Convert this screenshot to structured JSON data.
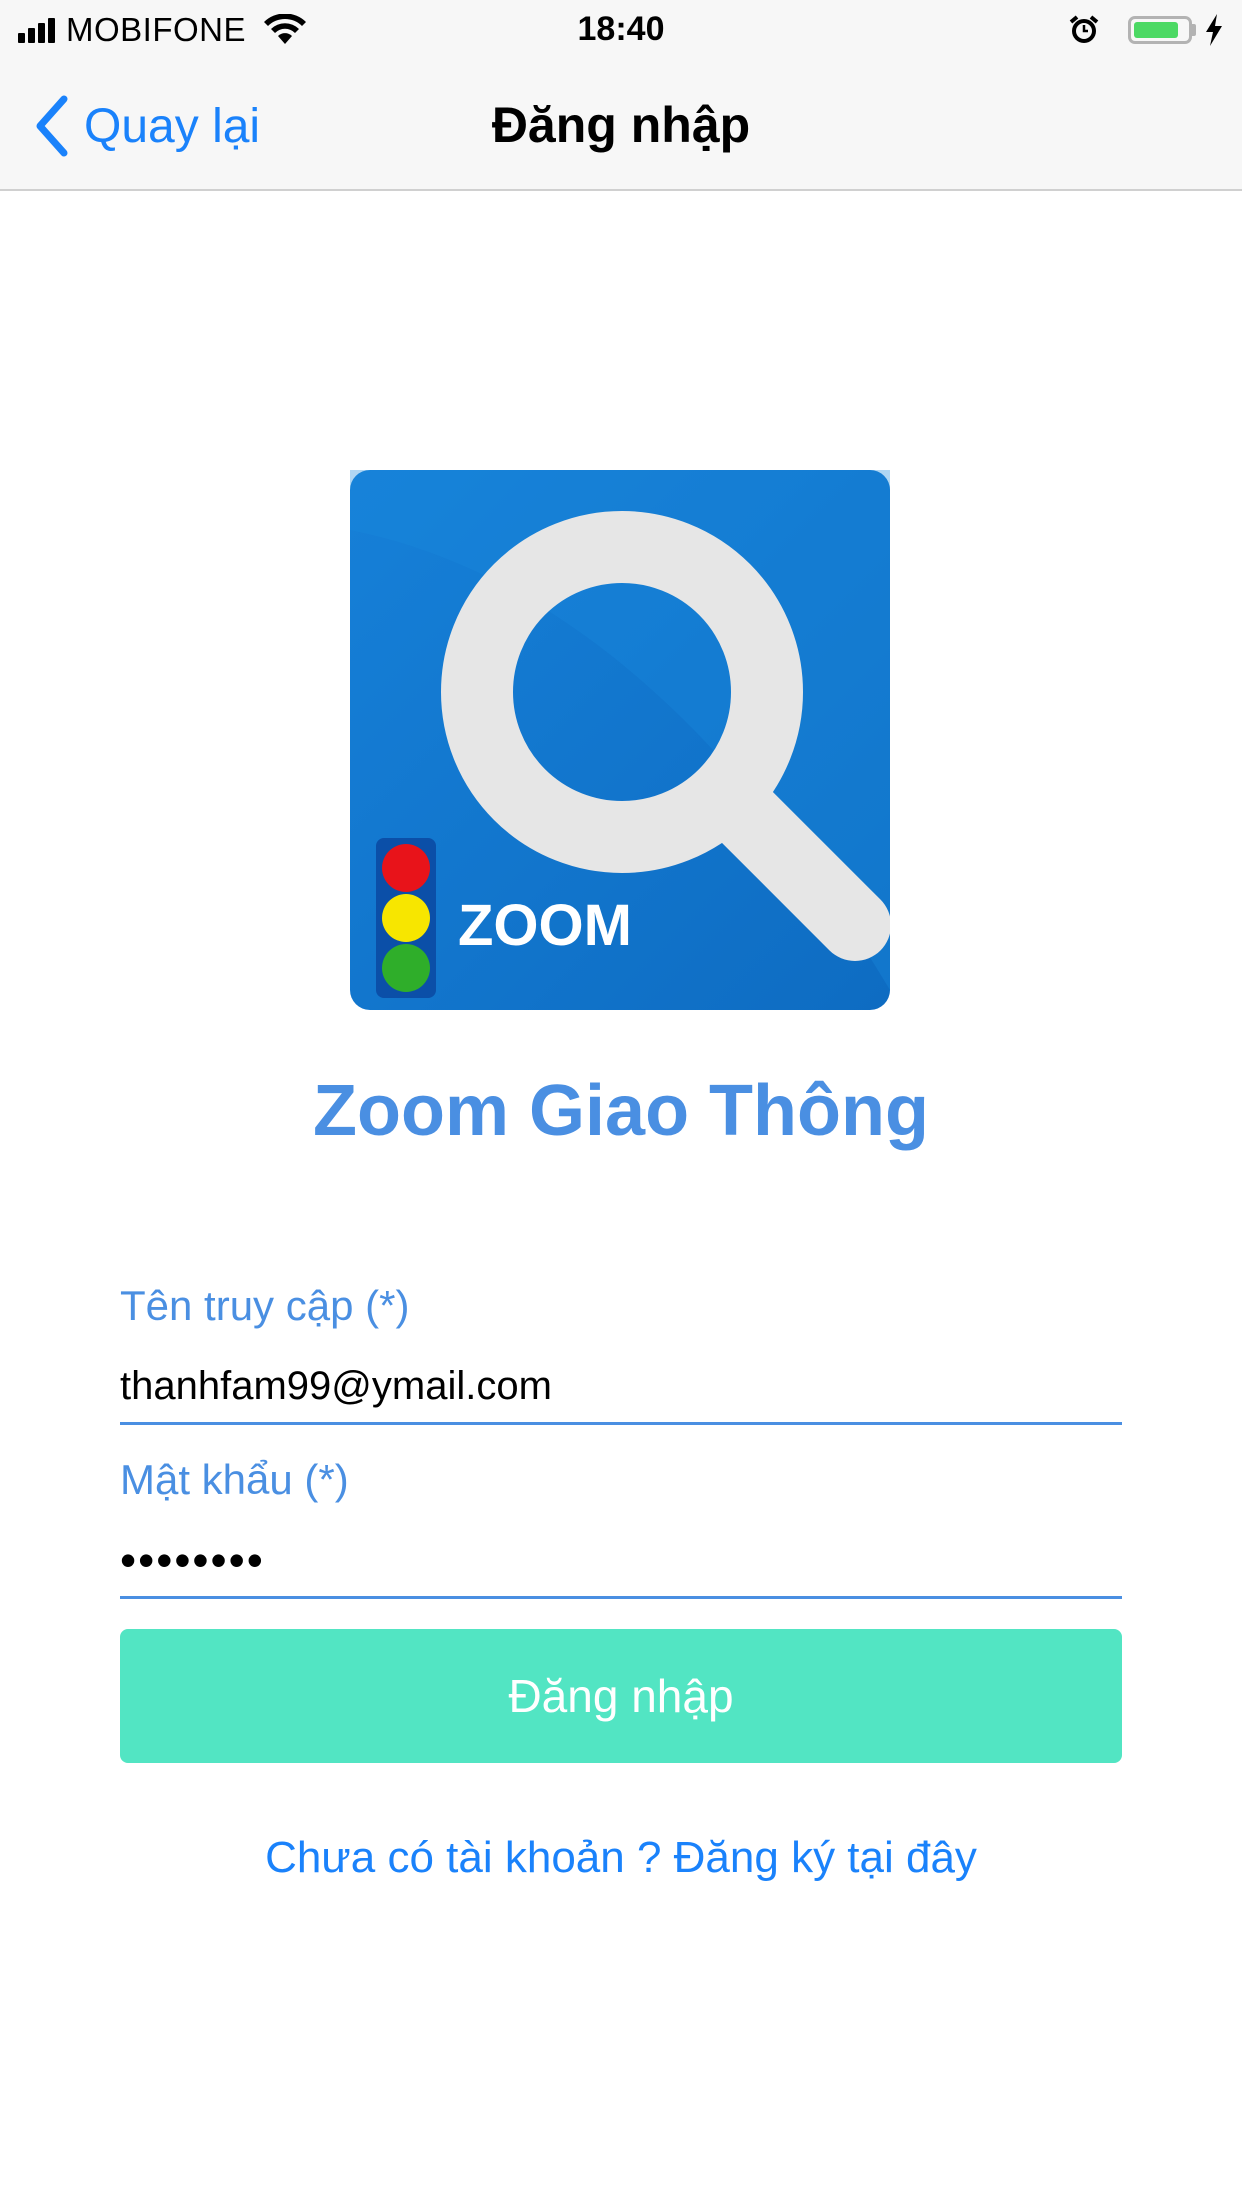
{
  "status_bar": {
    "carrier": "MOBIFONE",
    "time": "18:40",
    "signal_icon": "cellular-signal-icon",
    "wifi_icon": "wifi-icon",
    "alarm_icon": "alarm-clock-icon",
    "battery_icon": "battery-icon",
    "charging_icon": "charging-bolt-icon",
    "battery_level": 0.85,
    "battery_color": "#4cd964"
  },
  "nav": {
    "back_label": "Quay lại",
    "back_icon": "chevron-left-icon",
    "title": "Đăng nhập"
  },
  "logo": {
    "text": "ZOOM",
    "icon": "magnifier-traffic-light-logo",
    "colors": {
      "background": "#1278cf",
      "red": "#e8131a",
      "yellow": "#f7e600",
      "green": "#2fae2a"
    }
  },
  "app_title": "Zoom Giao Thông",
  "form": {
    "username": {
      "label": "Tên truy cập (*)",
      "value": "thanhfam99@ymail.com"
    },
    "password": {
      "label": "Mật khẩu (*)",
      "value": "••••••••"
    },
    "submit_label": "Đăng nhập",
    "register_link": "Chưa có tài khoản ? Đăng ký tại đây"
  },
  "colors": {
    "accent_blue": "#1a82fb",
    "label_blue": "#4a8fe2",
    "button_teal": "#52e5c3"
  }
}
